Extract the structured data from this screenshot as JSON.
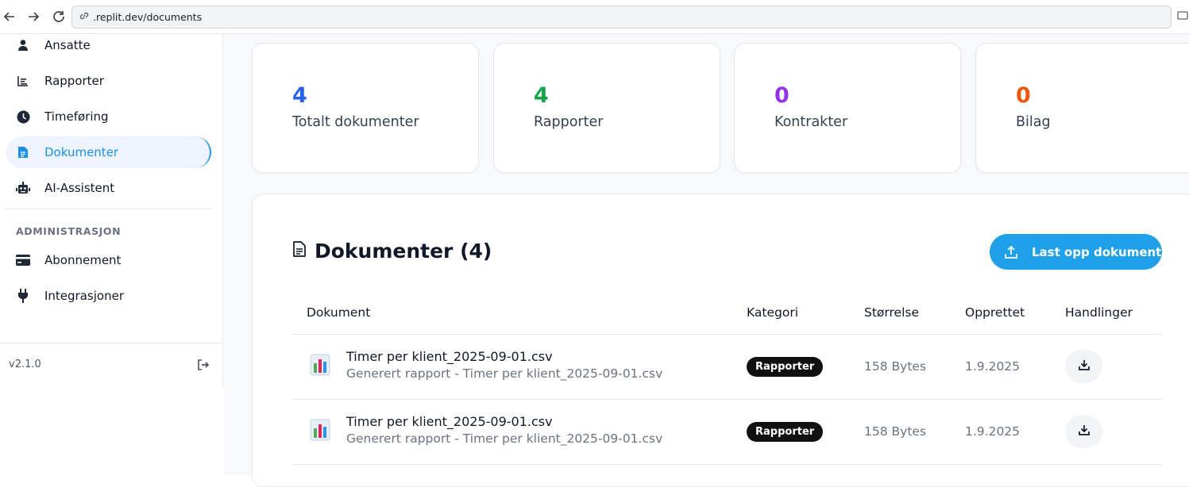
{
  "browser": {
    "url": ".replit.dev/documents"
  },
  "sidebar": {
    "items": [
      {
        "label": "Ansatte",
        "icon": "person-icon"
      },
      {
        "label": "Rapporter",
        "icon": "bar-chart-icon"
      },
      {
        "label": "Timeføring",
        "icon": "clock-icon"
      },
      {
        "label": "Dokumenter",
        "icon": "document-icon",
        "active": true
      },
      {
        "label": "AI-Assistent",
        "icon": "robot-icon"
      }
    ],
    "section_label": "ADMINISTRASJON",
    "admin_items": [
      {
        "label": "Abonnement",
        "icon": "credit-card-icon"
      },
      {
        "label": "Integrasjoner",
        "icon": "plug-icon"
      }
    ],
    "version": "v2.1.0"
  },
  "stats": [
    {
      "value": "4",
      "label": "Totalt dokumenter",
      "color": "#2563eb"
    },
    {
      "value": "4",
      "label": "Rapporter",
      "color": "#16a34a"
    },
    {
      "value": "0",
      "label": "Kontrakter",
      "color": "#9333ea"
    },
    {
      "value": "0",
      "label": "Bilag",
      "color": "#ea580c"
    }
  ],
  "documents": {
    "title": "Dokumenter (4)",
    "upload_label": "Last opp dokument",
    "columns": [
      "Dokument",
      "Kategori",
      "Størrelse",
      "Opprettet",
      "Handlinger"
    ],
    "rows": [
      {
        "name": "Timer per klient_2025-09-01.csv",
        "description": "Generert rapport - Timer per klient_2025-09-01.csv",
        "category": "Rapporter",
        "size": "158 Bytes",
        "created": "1.9.2025"
      },
      {
        "name": "Timer per klient_2025-09-01.csv",
        "description": "Generert rapport - Timer per klient_2025-09-01.csv",
        "category": "Rapporter",
        "size": "158 Bytes",
        "created": "1.9.2025"
      }
    ]
  }
}
